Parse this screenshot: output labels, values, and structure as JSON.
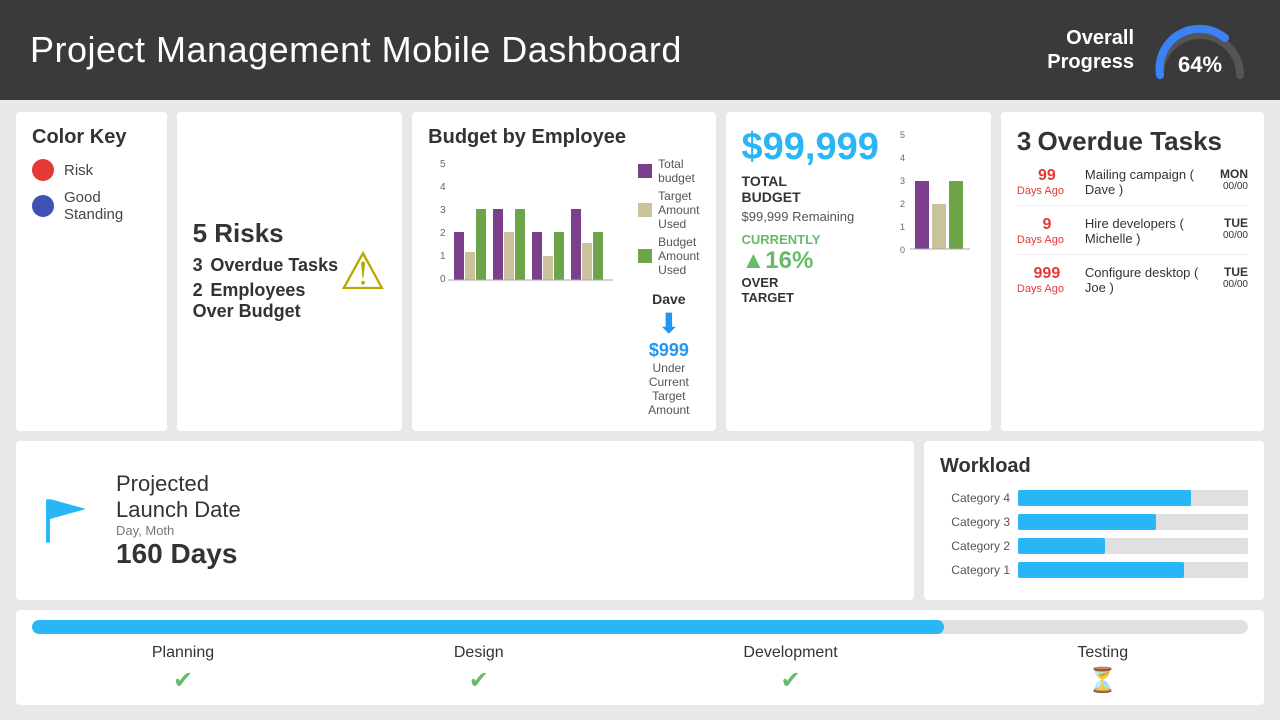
{
  "header": {
    "title": "Project Management Mobile Dashboard",
    "progress_label": "Overall\nProgress",
    "progress_pct": "64%"
  },
  "color_key": {
    "title": "Color Key",
    "items": [
      {
        "label": "Risk",
        "color": "#e53935"
      },
      {
        "label": "Good\nStanding",
        "color": "#3f51b5"
      }
    ]
  },
  "risks": {
    "title": "5 Risks",
    "overdue_count": "3",
    "overdue_label": "Overdue Tasks",
    "over_budget_count": "2",
    "over_budget_label": "Employees Over Budget"
  },
  "budget_employee": {
    "title": "Budget by Employee",
    "legend": [
      {
        "label": "Total budget",
        "color": "#7b3f8c"
      },
      {
        "label": "Target Amount Used",
        "color": "#c9c29c"
      },
      {
        "label": "Budget Amount Used",
        "color": "#6da44a"
      }
    ],
    "dave": {
      "name": "Dave",
      "amount": "$999",
      "sub1": "Under Current",
      "sub2": "Target Amount"
    }
  },
  "total_budget": {
    "amount": "$99,999",
    "label": "TOTAL\nBUDGET",
    "remaining": "$99,999 Remaining",
    "currently_label": "CURRENTLY",
    "currently_pct": "▲16%",
    "over_target": "OVER\nTARGET"
  },
  "overdue": {
    "title": "Overdue Tasks",
    "count": "3",
    "tasks": [
      {
        "days": "99",
        "days_label": "Days Ago",
        "desc": "Mailing campaign ( Dave )",
        "day_name": "MON",
        "date": "00/00"
      },
      {
        "days": "9",
        "days_label": "Days Ago",
        "desc": "Hire developers ( Michelle )",
        "day_name": "TUE",
        "date": "00/00"
      },
      {
        "days": "999",
        "days_label": "Days Ago",
        "desc": "Configure desktop ( Joe )",
        "day_name": "TUE",
        "date": "00/00"
      }
    ]
  },
  "launch": {
    "title": "Projected\nLaunch Date",
    "sub": "Day, Moth",
    "days": "160 Days"
  },
  "workload": {
    "title": "Workload",
    "categories": [
      {
        "label": "Category 4",
        "pct": 75
      },
      {
        "label": "Category 3",
        "pct": 60
      },
      {
        "label": "Category 2",
        "pct": 38
      },
      {
        "label": "Category 1",
        "pct": 72
      }
    ]
  },
  "phases": {
    "progress_pct": 75,
    "items": [
      {
        "name": "Planning",
        "status": "done"
      },
      {
        "name": "Design",
        "status": "done"
      },
      {
        "name": "Development",
        "status": "done"
      },
      {
        "name": "Testing",
        "status": "pending"
      }
    ]
  }
}
